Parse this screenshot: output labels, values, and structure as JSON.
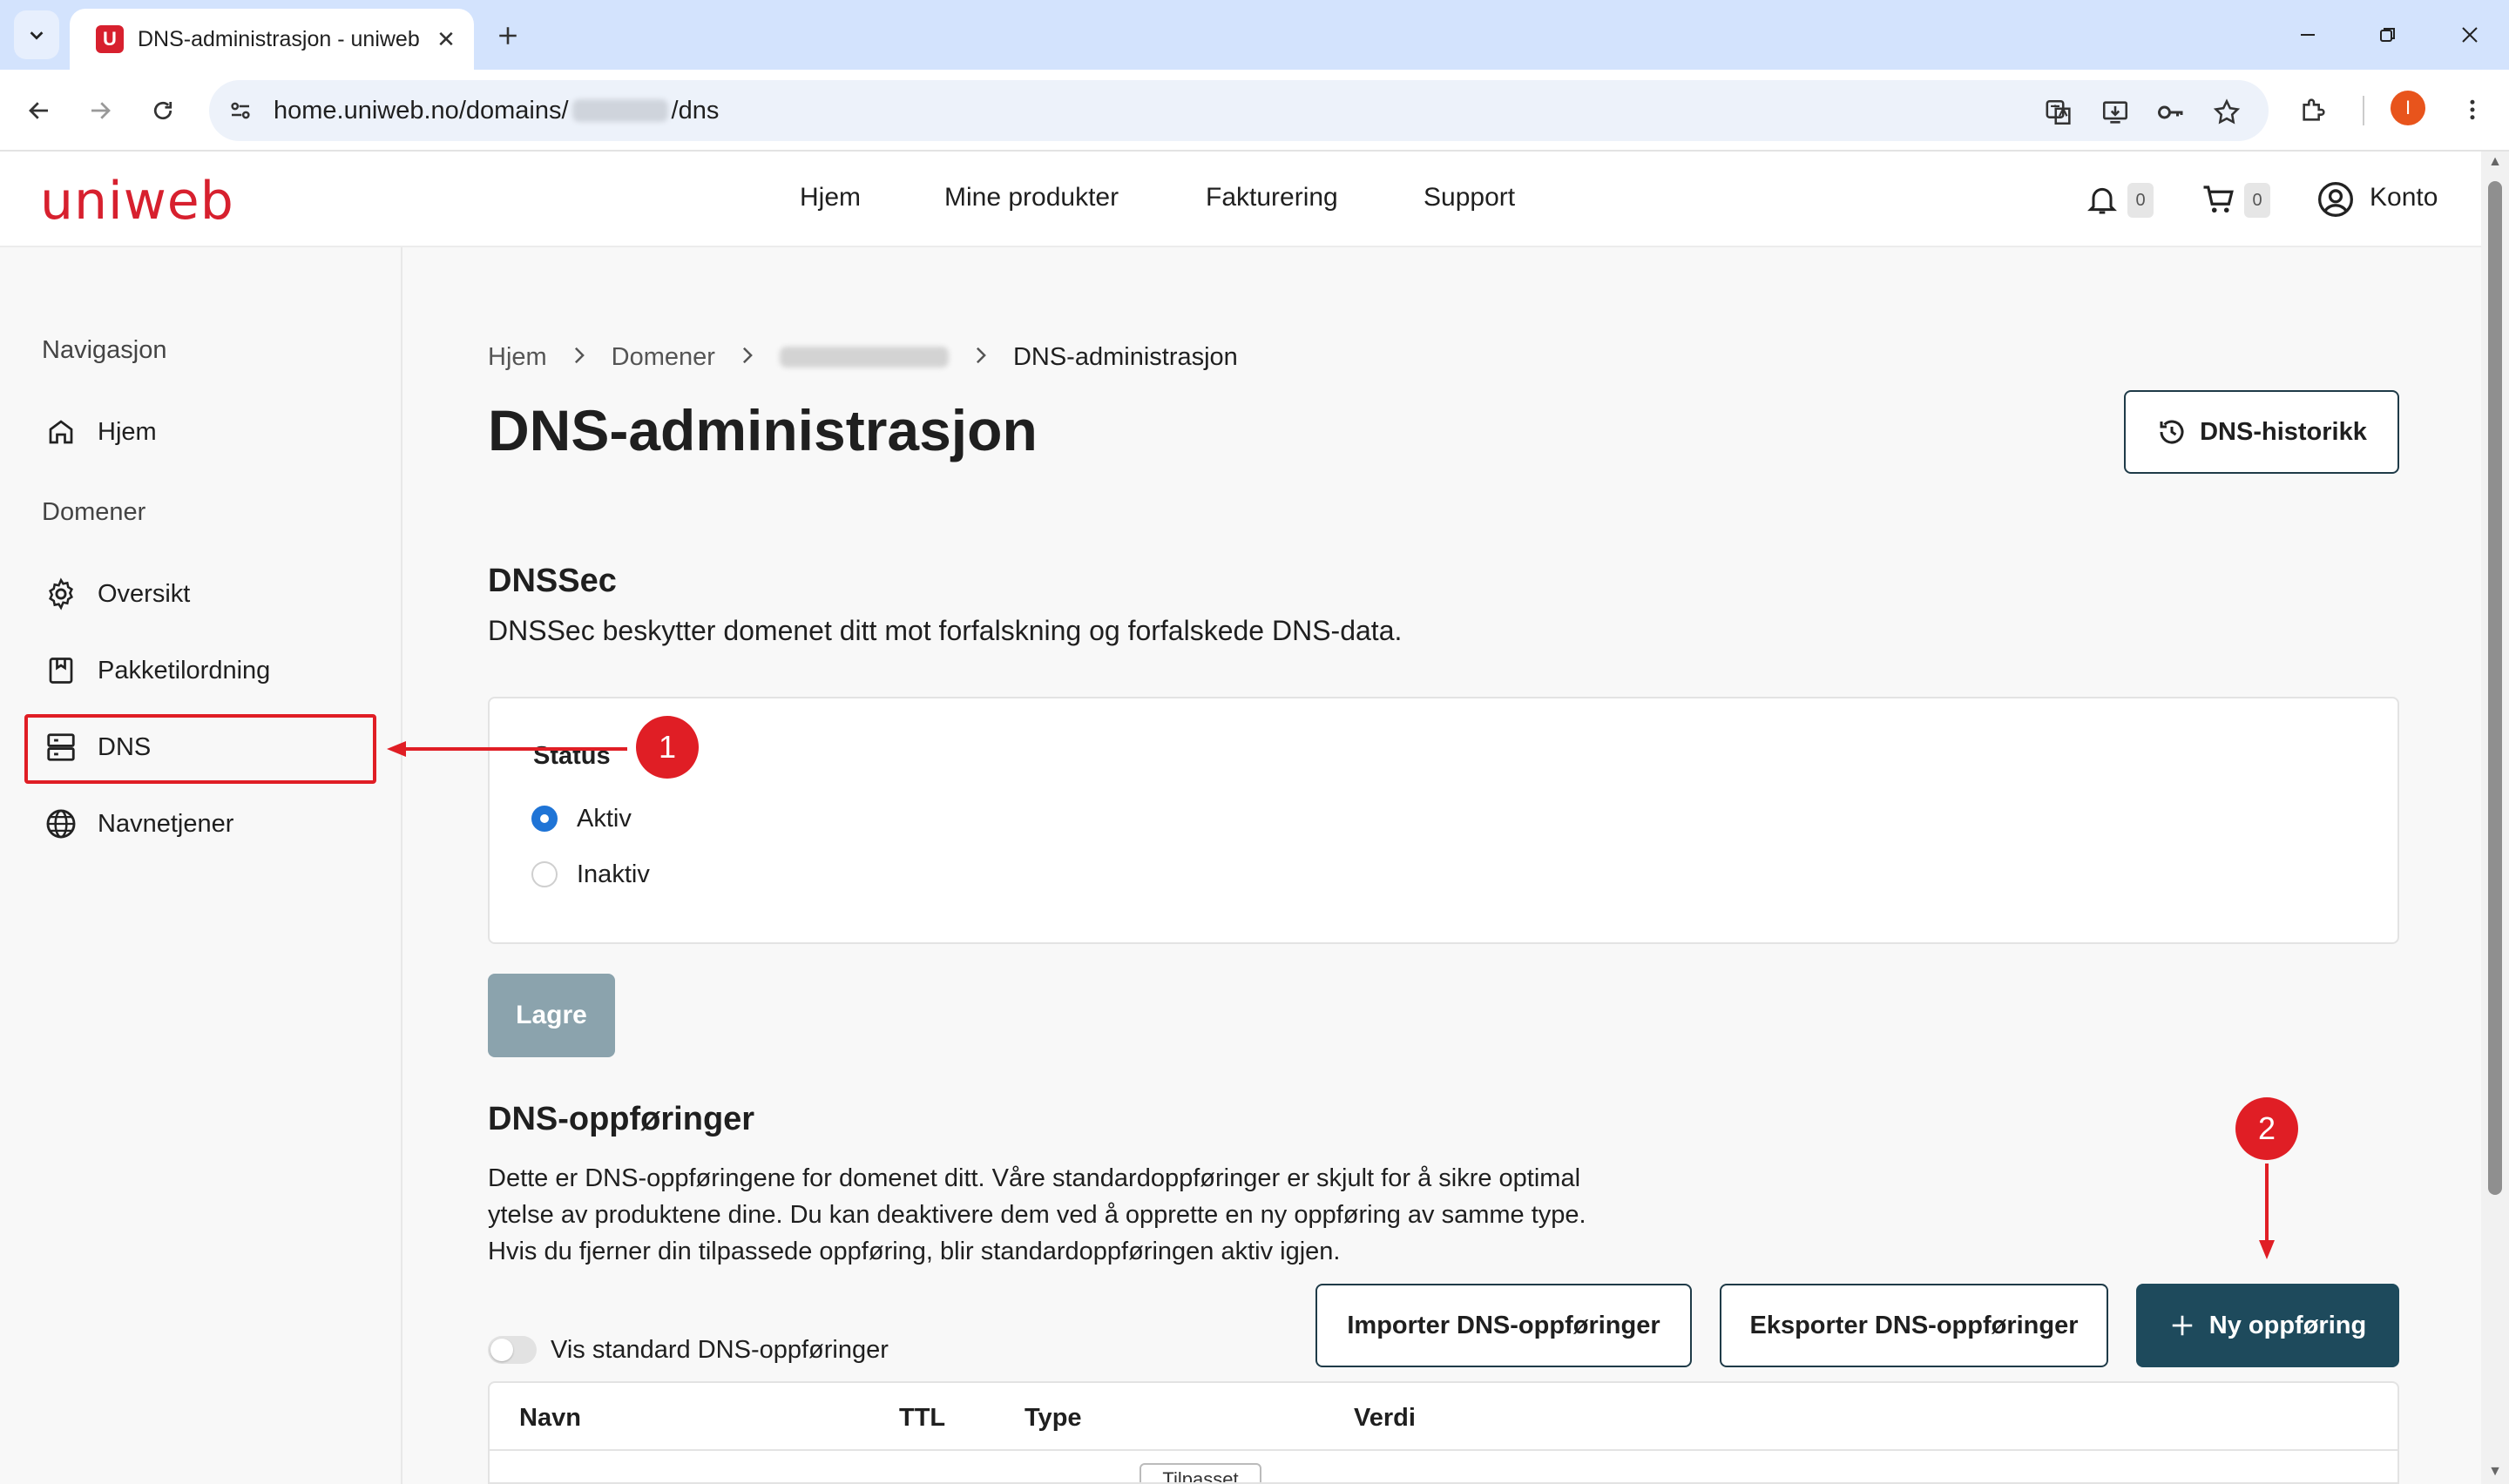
{
  "browser": {
    "tab_title": "DNS-administrasjon - uniweb",
    "favicon_letter": "U",
    "url_prefix": "home.uniweb.no/domains/",
    "url_suffix": "/dns",
    "profile_initial": "I"
  },
  "header": {
    "logo": "uniweb",
    "nav": [
      "Hjem",
      "Mine produkter",
      "Fakturering",
      "Support"
    ],
    "notifications_count": "0",
    "cart_count": "0",
    "account_label": "Konto"
  },
  "sidebar": {
    "heading_nav": "Navigasjon",
    "item_home": "Hjem",
    "heading_domains": "Domener",
    "items": [
      "Oversikt",
      "Pakketilordning",
      "DNS",
      "Navnetjener"
    ]
  },
  "annotations": {
    "step1": "1",
    "step2": "2",
    "color": "#e01e25"
  },
  "breadcrumb": {
    "home": "Hjem",
    "domains": "Domener",
    "current": "DNS-administrasjon"
  },
  "page": {
    "title": "DNS-administrasjon",
    "history_button": "DNS-historikk"
  },
  "dnssec": {
    "title": "DNSSec",
    "description": "DNSSec beskytter domenet ditt mot forfalskning og forfalskede DNS-data.",
    "status_label": "Status",
    "option_active": "Aktiv",
    "option_inactive": "Inaktiv",
    "selected": "Aktiv",
    "save_button": "Lagre"
  },
  "records": {
    "title": "DNS-oppføringer",
    "description_line1": "Dette er DNS-oppføringene for domenet ditt. Våre standardoppføringer er skjult for å sikre optimal",
    "description_line2": "ytelse av produktene dine. Du kan deaktivere dem ved å opprette en ny oppføring av samme type.",
    "description_line3": "Hvis du fjerner din tilpassede oppføring, blir standardoppføringen aktiv igjen.",
    "import_button": "Importer DNS-oppføringer",
    "export_button": "Eksporter DNS-oppføringer",
    "new_button": "Ny oppføring",
    "toggle_label": "Vis standard DNS-oppføringer",
    "columns": [
      "Navn",
      "TTL",
      "Type",
      "Verdi"
    ],
    "first_row_chip": "Tilpasset"
  },
  "colors": {
    "brand": "#d7202e",
    "primary": "#1e4a5c",
    "radio": "#1f74d6"
  }
}
